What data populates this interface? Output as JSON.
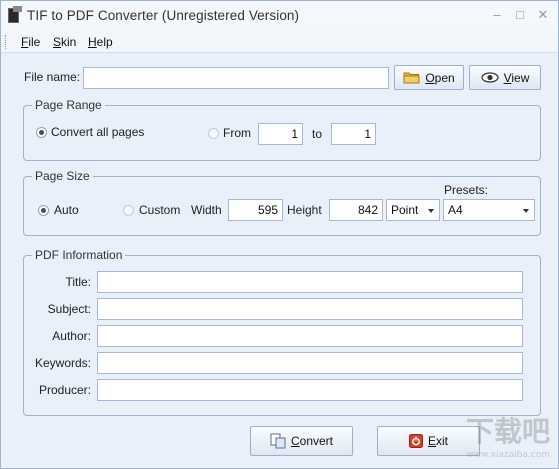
{
  "window": {
    "title": "TIF to PDF Converter (Unregistered Version)",
    "minimize_glyph": "–",
    "maximize_glyph": "□",
    "close_glyph": "✕"
  },
  "menu": {
    "items": [
      {
        "label": "File"
      },
      {
        "label": "Skin"
      },
      {
        "label": "Help"
      }
    ]
  },
  "file": {
    "label": "File name:",
    "value": "",
    "open_label": "Open",
    "view_label": "View"
  },
  "page_range": {
    "title": "Page Range",
    "all_label": "Convert all pages",
    "from_label": "From",
    "to_label": "to",
    "from_value": "1",
    "to_value": "1",
    "selected": "all"
  },
  "page_size": {
    "title": "Page Size",
    "auto_label": "Auto",
    "custom_label": "Custom",
    "width_label": "Width",
    "width_value": "595",
    "height_label": "Height",
    "height_value": "842",
    "unit": "Point",
    "presets_label": "Presets:",
    "preset": "A4",
    "selected": "auto"
  },
  "pdf_info": {
    "title": "PDF Information",
    "fields": [
      {
        "label": "Title:",
        "value": ""
      },
      {
        "label": "Subject:",
        "value": ""
      },
      {
        "label": "Author:",
        "value": ""
      },
      {
        "label": "Keywords:",
        "value": ""
      },
      {
        "label": "Producer:",
        "value": ""
      }
    ]
  },
  "actions": {
    "convert_label": "Convert",
    "exit_label": "Exit"
  },
  "watermark": {
    "main": "下载吧",
    "sub": "www.xiazaiba.com"
  },
  "colors": {
    "accent_border": "#9fb3cf",
    "background": "#e9f0fa",
    "exit_icon": "#d9402b",
    "folder_icon": "#e8b540"
  }
}
